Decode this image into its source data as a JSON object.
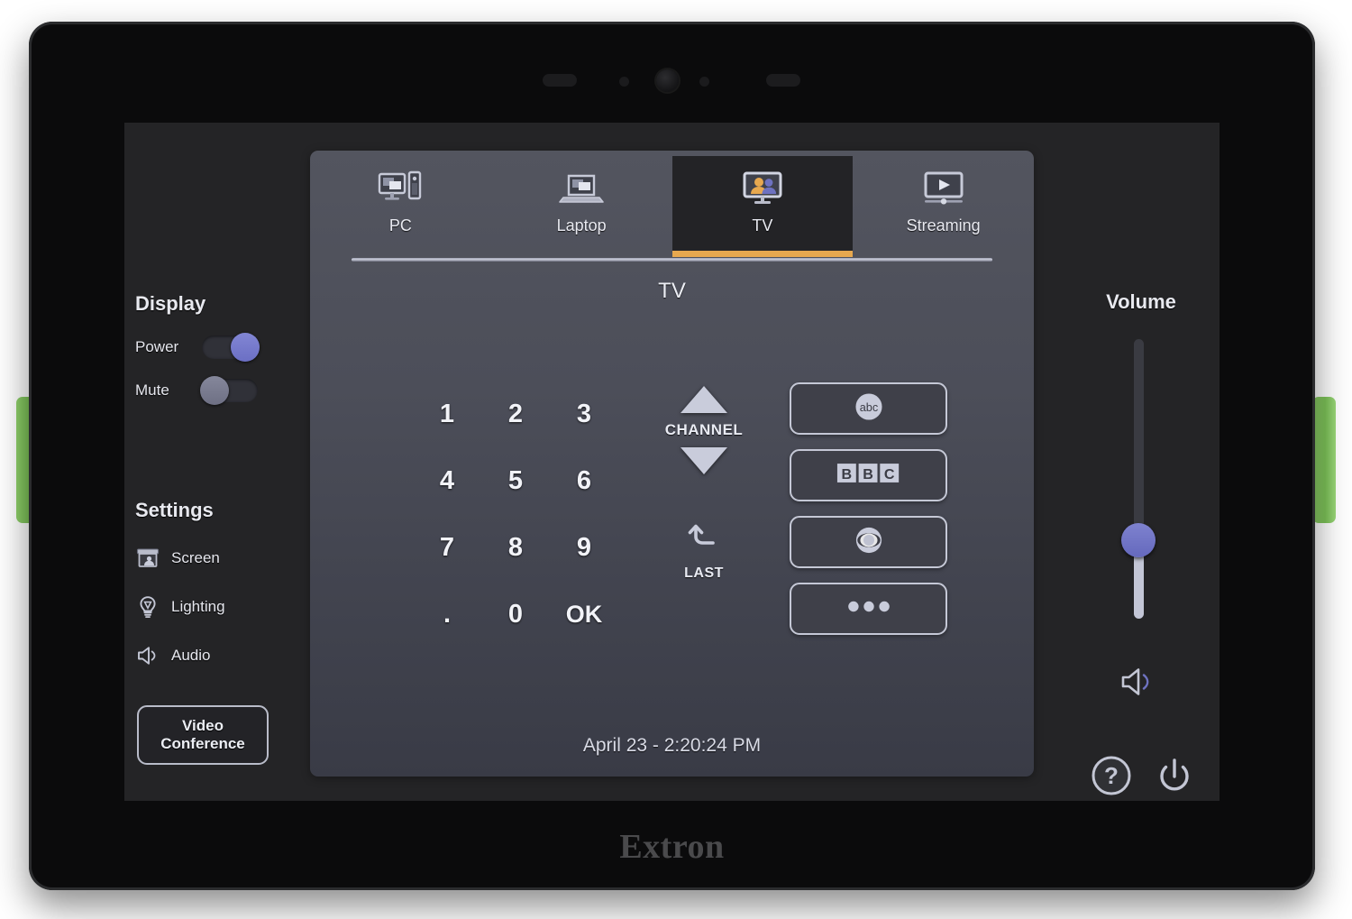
{
  "device": {
    "brand": "Extron",
    "bezel": {
      "camera": "camera-lens",
      "speaker_slots": 2,
      "sensor_dots": 2
    }
  },
  "tabs": [
    {
      "id": "pc",
      "label": "PC",
      "icon": "desktop-computer-icon",
      "active": false
    },
    {
      "id": "laptop",
      "label": "Laptop",
      "icon": "laptop-icon",
      "active": false
    },
    {
      "id": "tv",
      "label": "TV",
      "icon": "tv-people-icon",
      "active": true
    },
    {
      "id": "streaming",
      "label": "Streaming",
      "icon": "video-play-icon",
      "active": false
    }
  ],
  "panel": {
    "title": "TV",
    "clock": "April 23 - 2:20:24 PM",
    "accent_color": "#e7a84f"
  },
  "sidebar": {
    "display": {
      "title": "Display",
      "toggles": [
        {
          "id": "power",
          "label": "Power",
          "state": "on",
          "knob_color": "#7b7fcc"
        },
        {
          "id": "mute",
          "label": "Mute",
          "state": "off",
          "knob_color": "#7a7c90"
        }
      ]
    },
    "settings": {
      "title": "Settings",
      "items": [
        {
          "id": "screen",
          "label": "Screen",
          "icon": "projector-screen-icon"
        },
        {
          "id": "lighting",
          "label": "Lighting",
          "icon": "lightbulb-icon"
        },
        {
          "id": "audio",
          "label": "Audio",
          "icon": "speaker-icon"
        }
      ]
    },
    "video_conference": {
      "line1": "Video",
      "line2": "Conference"
    }
  },
  "volume": {
    "title": "Volume",
    "level_percent": 28,
    "knob_color": "#7b7fcc",
    "mute_icon": "speaker-mute-icon"
  },
  "footer_buttons": [
    {
      "id": "help",
      "icon": "question-mark-circle-icon"
    },
    {
      "id": "power",
      "icon": "power-icon"
    }
  ],
  "keypad": {
    "keys": [
      "1",
      "2",
      "3",
      "4",
      "5",
      "6",
      "7",
      "8",
      "9",
      ".",
      "0",
      "OK"
    ]
  },
  "channel": {
    "up_icon": "triangle-up-icon",
    "label": "CHANNEL",
    "down_icon": "triangle-down-icon",
    "last_icon": "back-arrow-icon",
    "last_label": "LAST"
  },
  "presets": [
    {
      "id": "abc",
      "label": "abc",
      "icon": "abc-logo-icon"
    },
    {
      "id": "bbc",
      "label": "BBC",
      "icon": "bbc-logo-icon"
    },
    {
      "id": "cbs",
      "label": "CBS",
      "icon": "cbs-eye-logo-icon"
    },
    {
      "id": "more",
      "label": "More",
      "icon": "ellipsis-icon"
    }
  ]
}
